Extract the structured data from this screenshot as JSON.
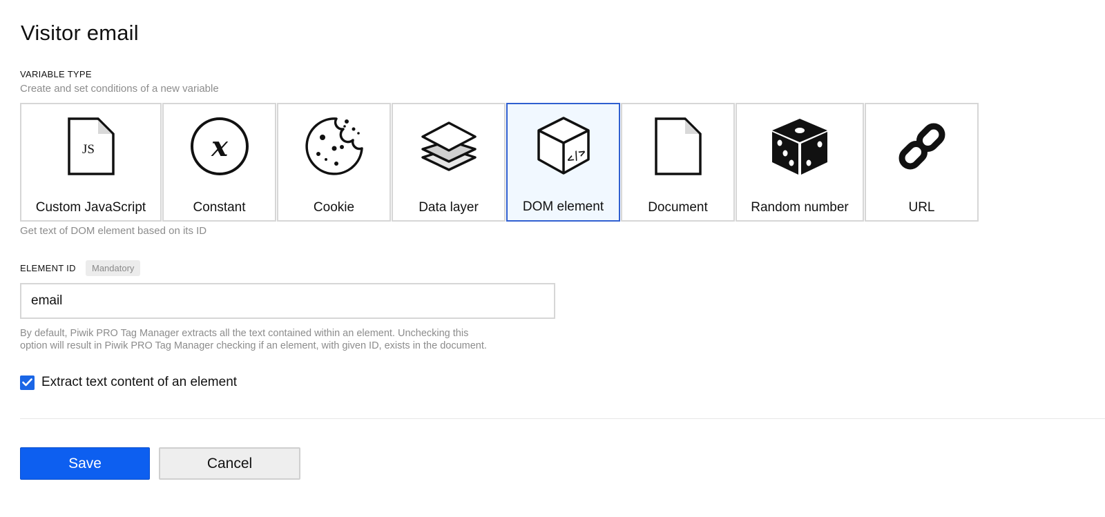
{
  "page": {
    "title": "Visitor  email"
  },
  "variable_type": {
    "section_label": "VARIABLE TYPE",
    "description": "Create and set conditions of a new variable",
    "types": [
      {
        "label": "Custom JavaScript",
        "icon": "javascript-file-icon",
        "selected": false
      },
      {
        "label": "Constant",
        "icon": "constant-x-icon",
        "selected": false
      },
      {
        "label": "Cookie",
        "icon": "cookie-icon",
        "selected": false
      },
      {
        "label": "Data layer",
        "icon": "layers-icon",
        "selected": false
      },
      {
        "label": "DOM element",
        "icon": "code-cube-icon",
        "selected": true
      },
      {
        "label": "Document",
        "icon": "document-icon",
        "selected": false
      },
      {
        "label": "Random number",
        "icon": "dice-icon",
        "selected": false
      },
      {
        "label": "URL",
        "icon": "link-icon",
        "selected": false
      }
    ],
    "selected_help": "Get text of DOM element based on its ID"
  },
  "element_id": {
    "label": "ELEMENT ID",
    "badge": "Mandatory",
    "value": "email",
    "help": "By default, Piwik PRO Tag Manager extracts all the text contained within an element. Unchecking this option will result in Piwik PRO Tag Manager checking if an element, with given ID, exists in the document."
  },
  "extract_option": {
    "label": "Extract text content of an element",
    "checked": true
  },
  "actions": {
    "save_label": "Save",
    "cancel_label": "Cancel"
  },
  "colors": {
    "accent": "#0d5ff0",
    "selected_border": "#2f5fd0",
    "selected_bg": "#f1f8ff",
    "muted_text": "#8c8c8c"
  }
}
